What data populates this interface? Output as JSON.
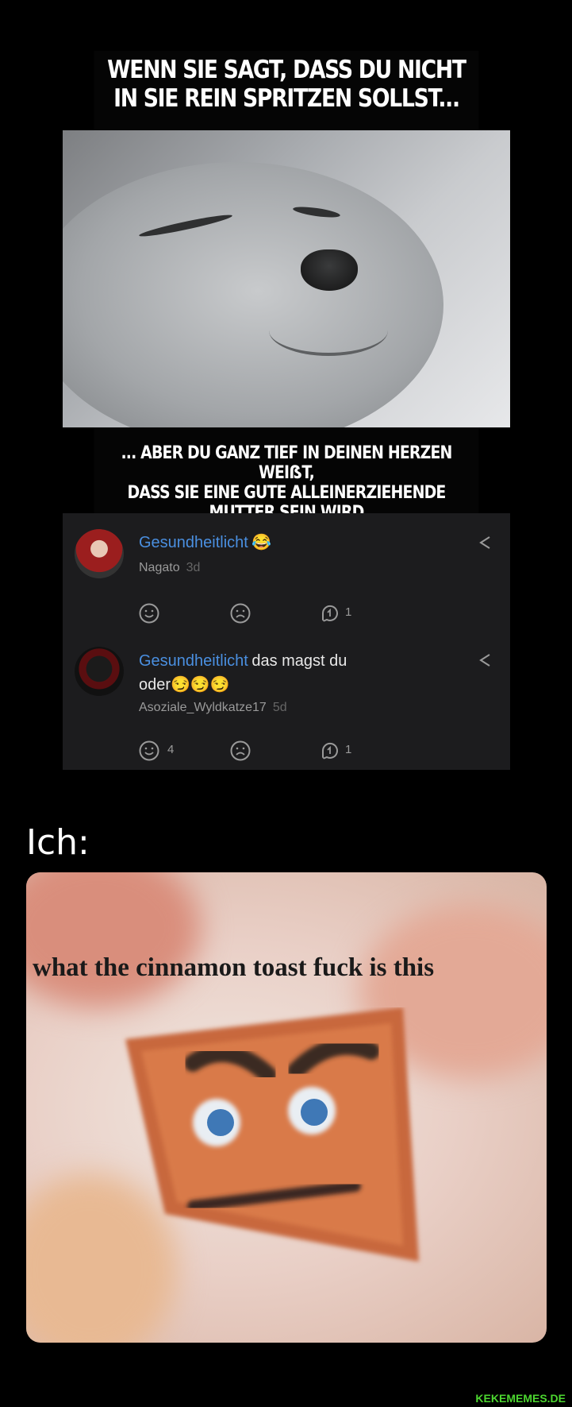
{
  "meme": {
    "top_caption_line1": "WENN SIE SAGT, DASS DU NICHT",
    "top_caption_line2": "IN SIE REIN SPRITZEN SOLLST...",
    "bottom_caption_line1": "... ABER DU GANZ TIEF IN DEINEN HERZEN WEIẞT,",
    "bottom_caption_line2": "DASS SIE EINE GUTE ALLEINERZIEHENDE",
    "bottom_caption_line3": "MUTTER SEIN WIRD"
  },
  "comments": [
    {
      "mention": "Gesundheitlicht",
      "text": "",
      "emoji": "😂",
      "author": "Nagato",
      "age": "3d",
      "like_count": "",
      "reply_count": "1"
    },
    {
      "mention": "Gesundheitlicht",
      "text_line1": "das magst du",
      "text_line2": "oder",
      "emoji": "😏😏😏",
      "author": "Asoziale_Wyldkatze17",
      "age": "5d",
      "like_count": "4",
      "reply_count": "1"
    }
  ],
  "reaction_heading": "Ich:",
  "reaction_meme_text": "what the cinnamon toast fuck is this",
  "watermark": "KEKEMEMES.DE",
  "colors": {
    "mention": "#4a8fe0",
    "watermark": "#4cd62f",
    "comment_bg": "#1c1c1e"
  },
  "icons": [
    "share-icon",
    "smile-icon",
    "frown-icon",
    "reply-icon"
  ]
}
